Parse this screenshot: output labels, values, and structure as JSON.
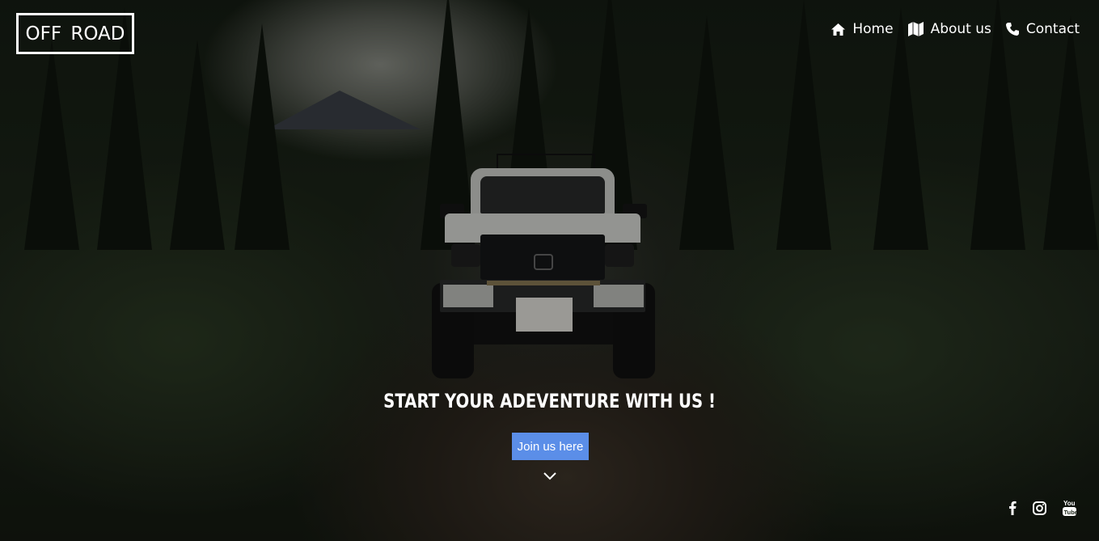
{
  "header": {
    "logo_text": "OFF ROAD",
    "nav": [
      {
        "label": "Home",
        "icon": "home-icon"
      },
      {
        "label": "About us",
        "icon": "map-icon"
      },
      {
        "label": "Contact",
        "icon": "phone-icon"
      }
    ]
  },
  "hero": {
    "headline": "START YOUR ADEVENTURE WITH US !",
    "cta_label": "Join us here",
    "scroll_icon": "chevron-down-icon",
    "background_image": "off-road truck on forest dirt trail"
  },
  "social": [
    {
      "icon": "facebook-icon"
    },
    {
      "icon": "instagram-icon"
    },
    {
      "icon": "youtube-icon"
    }
  ],
  "colors": {
    "accent": "#5b8ee8",
    "text": "#ffffff"
  }
}
